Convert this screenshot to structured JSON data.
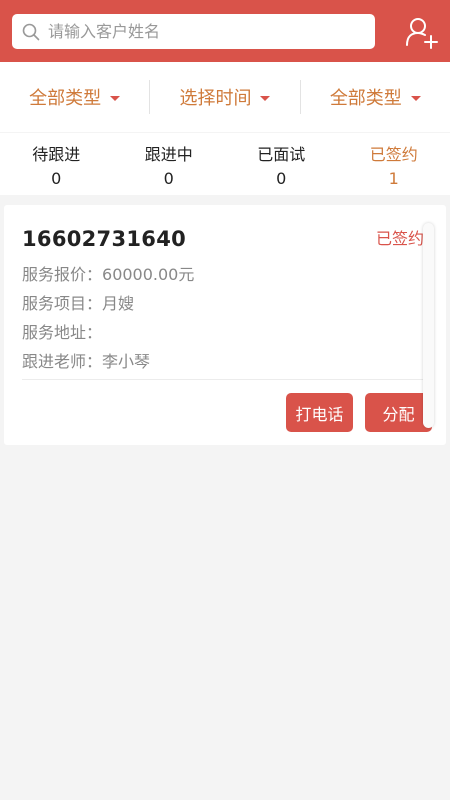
{
  "search": {
    "placeholder": "请输入客户姓名",
    "value": ""
  },
  "filters": [
    {
      "label": "全部类型"
    },
    {
      "label": "选择时间"
    },
    {
      "label": "全部类型"
    }
  ],
  "status_tabs": [
    {
      "label": "待跟进",
      "count": "0"
    },
    {
      "label": "跟进中",
      "count": "0"
    },
    {
      "label": "已面试",
      "count": "0"
    },
    {
      "label": "已签约",
      "count": "1",
      "active": true
    }
  ],
  "card": {
    "phone": "16602731640",
    "badge": "已签约",
    "price_label": "服务报价：",
    "price_value": "60000.00元",
    "project_label": "服务项目：",
    "project_value": "月嫂",
    "address_label": "服务地址：",
    "address_value": "",
    "teacher_label": "跟进老师：",
    "teacher_value": "李小琴",
    "call_label": "打电话",
    "assign_label": "分配"
  },
  "colors": {
    "primary": "#d9534a",
    "accent": "#cf7a3a",
    "background": "#f4f4f4"
  },
  "icons": {
    "search": "search-icon",
    "add_user": "add-user-icon",
    "caret": "caret-down-icon"
  }
}
